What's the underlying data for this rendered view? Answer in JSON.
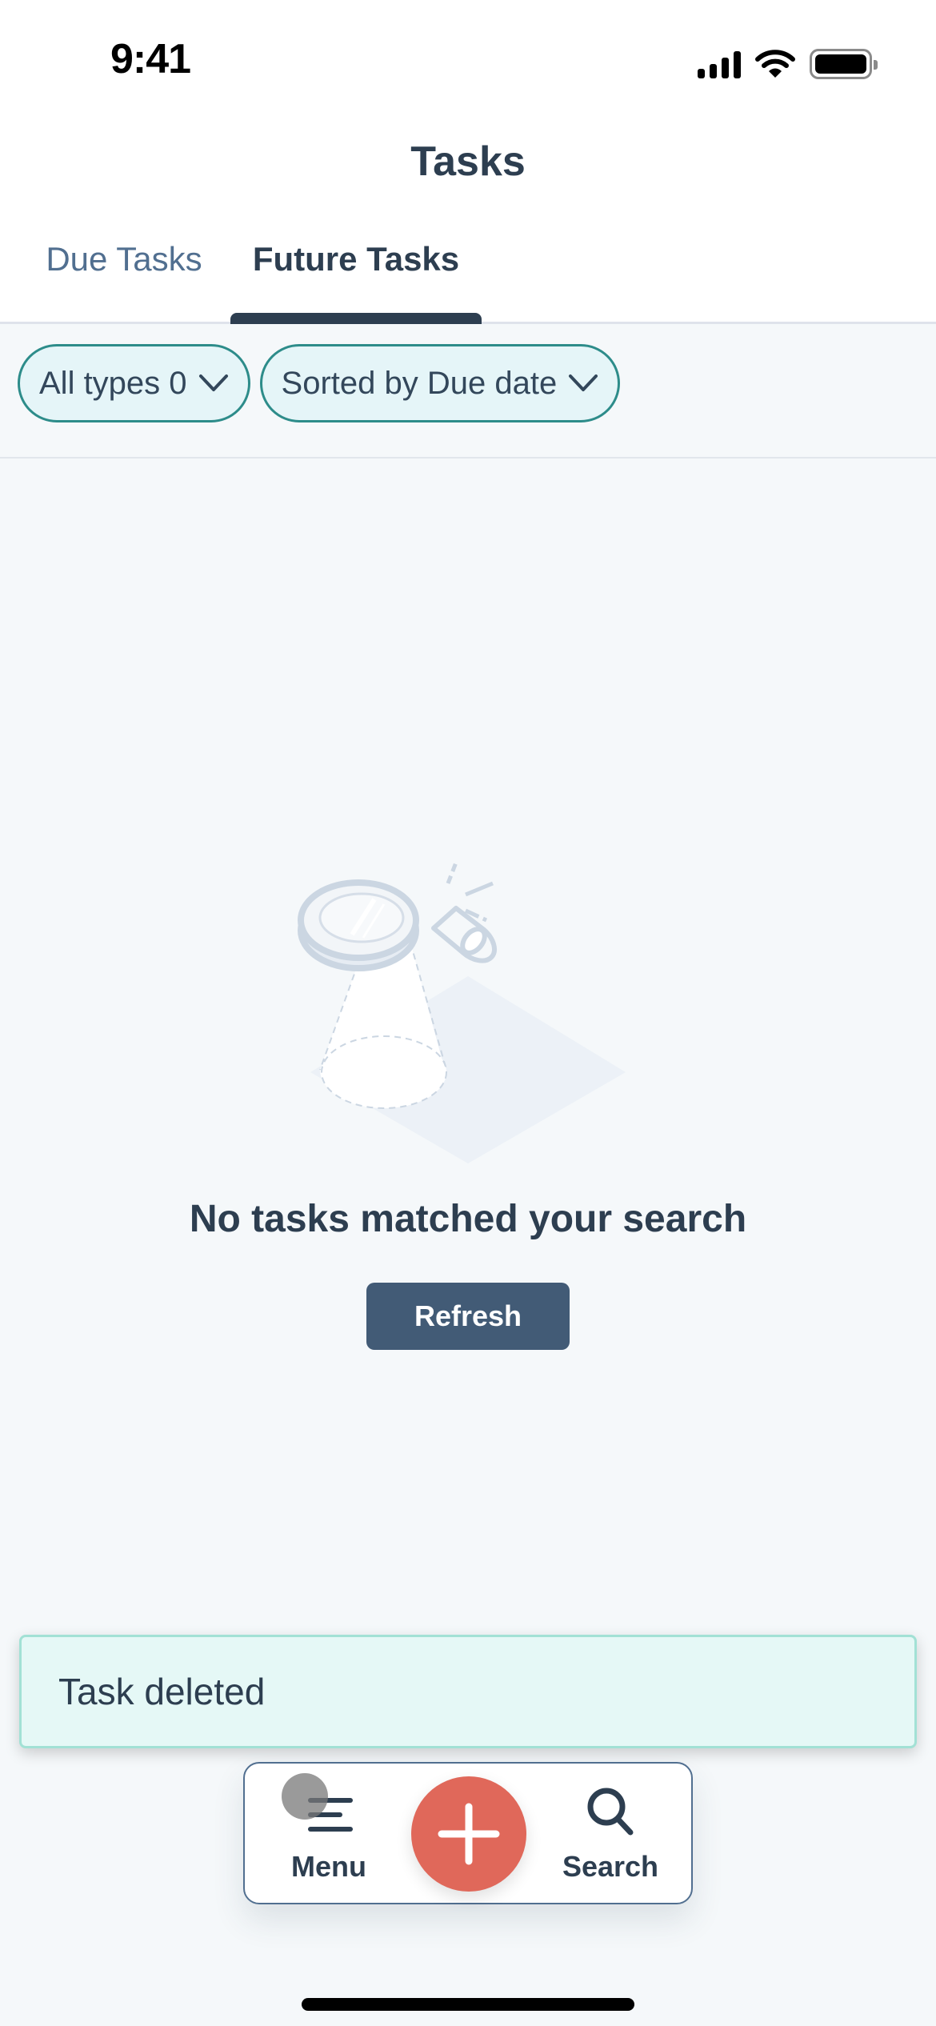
{
  "status_bar": {
    "time": "9:41",
    "icons": [
      "cellular-signal-icon",
      "wifi-icon",
      "battery-icon"
    ]
  },
  "header": {
    "title": "Tasks",
    "tabs": [
      {
        "label": "Due Tasks",
        "active": false
      },
      {
        "label": "Future Tasks",
        "active": true
      }
    ]
  },
  "filters": {
    "type_filter": {
      "label": "All types 0",
      "icon": "chevron-down-icon"
    },
    "sort": {
      "label": "Sorted by Due date",
      "icon": "chevron-down-icon"
    }
  },
  "empty_state": {
    "illustration": "magnifying-glass-illustration",
    "title": "No tasks matched your search",
    "button_label": "Refresh"
  },
  "toast": {
    "message": "Task deleted"
  },
  "bottom_nav": {
    "menu_label": "Menu",
    "search_label": "Search",
    "add_icon": "plus-icon"
  },
  "colors": {
    "primary_text": "#2d3e50",
    "secondary_text": "#516f90",
    "chip_border": "#2d8c8a",
    "chip_bg": "#e5f5f8",
    "button_bg": "#425b76",
    "fab": "#e0685a",
    "toast_bg": "#e5f8f6",
    "toast_border": "#a2e1d5",
    "page_bg": "#f5f8fa"
  }
}
